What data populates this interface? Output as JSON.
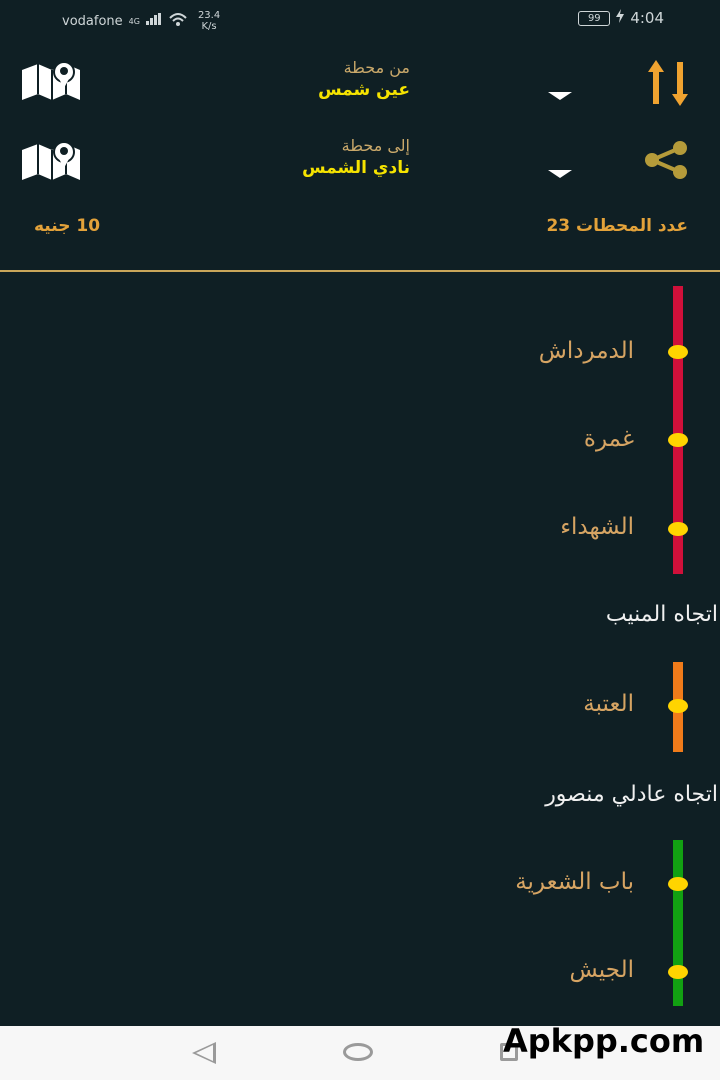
{
  "status_bar": {
    "carrier": "vodafone",
    "network": "4G",
    "speed_value": "23.4",
    "speed_unit": "K/s",
    "battery": "99",
    "time": "4:04"
  },
  "from": {
    "caption": "من محطة",
    "value": "عين شمس"
  },
  "to": {
    "caption": "إلى محطة",
    "value": "نادي الشمس"
  },
  "summary": {
    "stations_label": "عدد المحطات 23",
    "fare_label": "10 جنيه"
  },
  "route": {
    "colors": {
      "red": "#d0103a",
      "orange": "#f07b1a",
      "green": "#12a012",
      "dot": "#ffd400",
      "stop_text": "#d6a463",
      "accent": "#e3a23a"
    },
    "segment1_stops": [
      "الدمرداش",
      "غمرة",
      "الشهداء"
    ],
    "direction1": "اتجاه المنيب",
    "segment2_stops": [
      "العتبة"
    ],
    "direction2": "اتجاه عادلي منصور",
    "segment3_stops": [
      "باب الشعرية",
      "الجيش"
    ]
  },
  "icons": {
    "map": "map-pin-icon",
    "swap": "swap-vertical-icon",
    "share": "share-icon",
    "dropdown": "dropdown-arrow-icon"
  },
  "watermark": "Apkpp.com"
}
